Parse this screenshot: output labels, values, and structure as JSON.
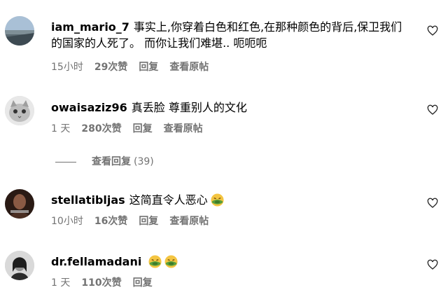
{
  "comments": [
    {
      "username": "iam_mario_7",
      "text": "事实上,你穿着白色和红色,在那种颜色的背后,保卫我们的国家的人死了。 而你让我们难堪.. 呃呃呃",
      "time": "15小时",
      "likes": "29次赞",
      "reply": "回复",
      "translate": "查看原帖"
    },
    {
      "username": "owaisaziz96",
      "text": "真丢脸 尊重别人的文化",
      "time": "1 天",
      "likes": "280次赞",
      "reply": "回复",
      "translate": "查看原帖"
    },
    {
      "username": "stellatibljas",
      "text": "这简直令人恶心",
      "time": "10小时",
      "likes": "16次赞",
      "reply": "回复",
      "translate": "查看原帖"
    },
    {
      "username": "dr.fellamadani",
      "text": "",
      "time": "1 天",
      "likes": "110次赞",
      "reply": "回复"
    }
  ],
  "view_replies": {
    "label": "查看回复",
    "count": "(39)"
  },
  "icons": {
    "like": "heart-icon",
    "emoji": "nauseated-face-emoji"
  },
  "colors": {
    "meta": "#737373",
    "text": "#000000",
    "emoji": "#f4c542",
    "emoji_face": "#5aa03c"
  }
}
